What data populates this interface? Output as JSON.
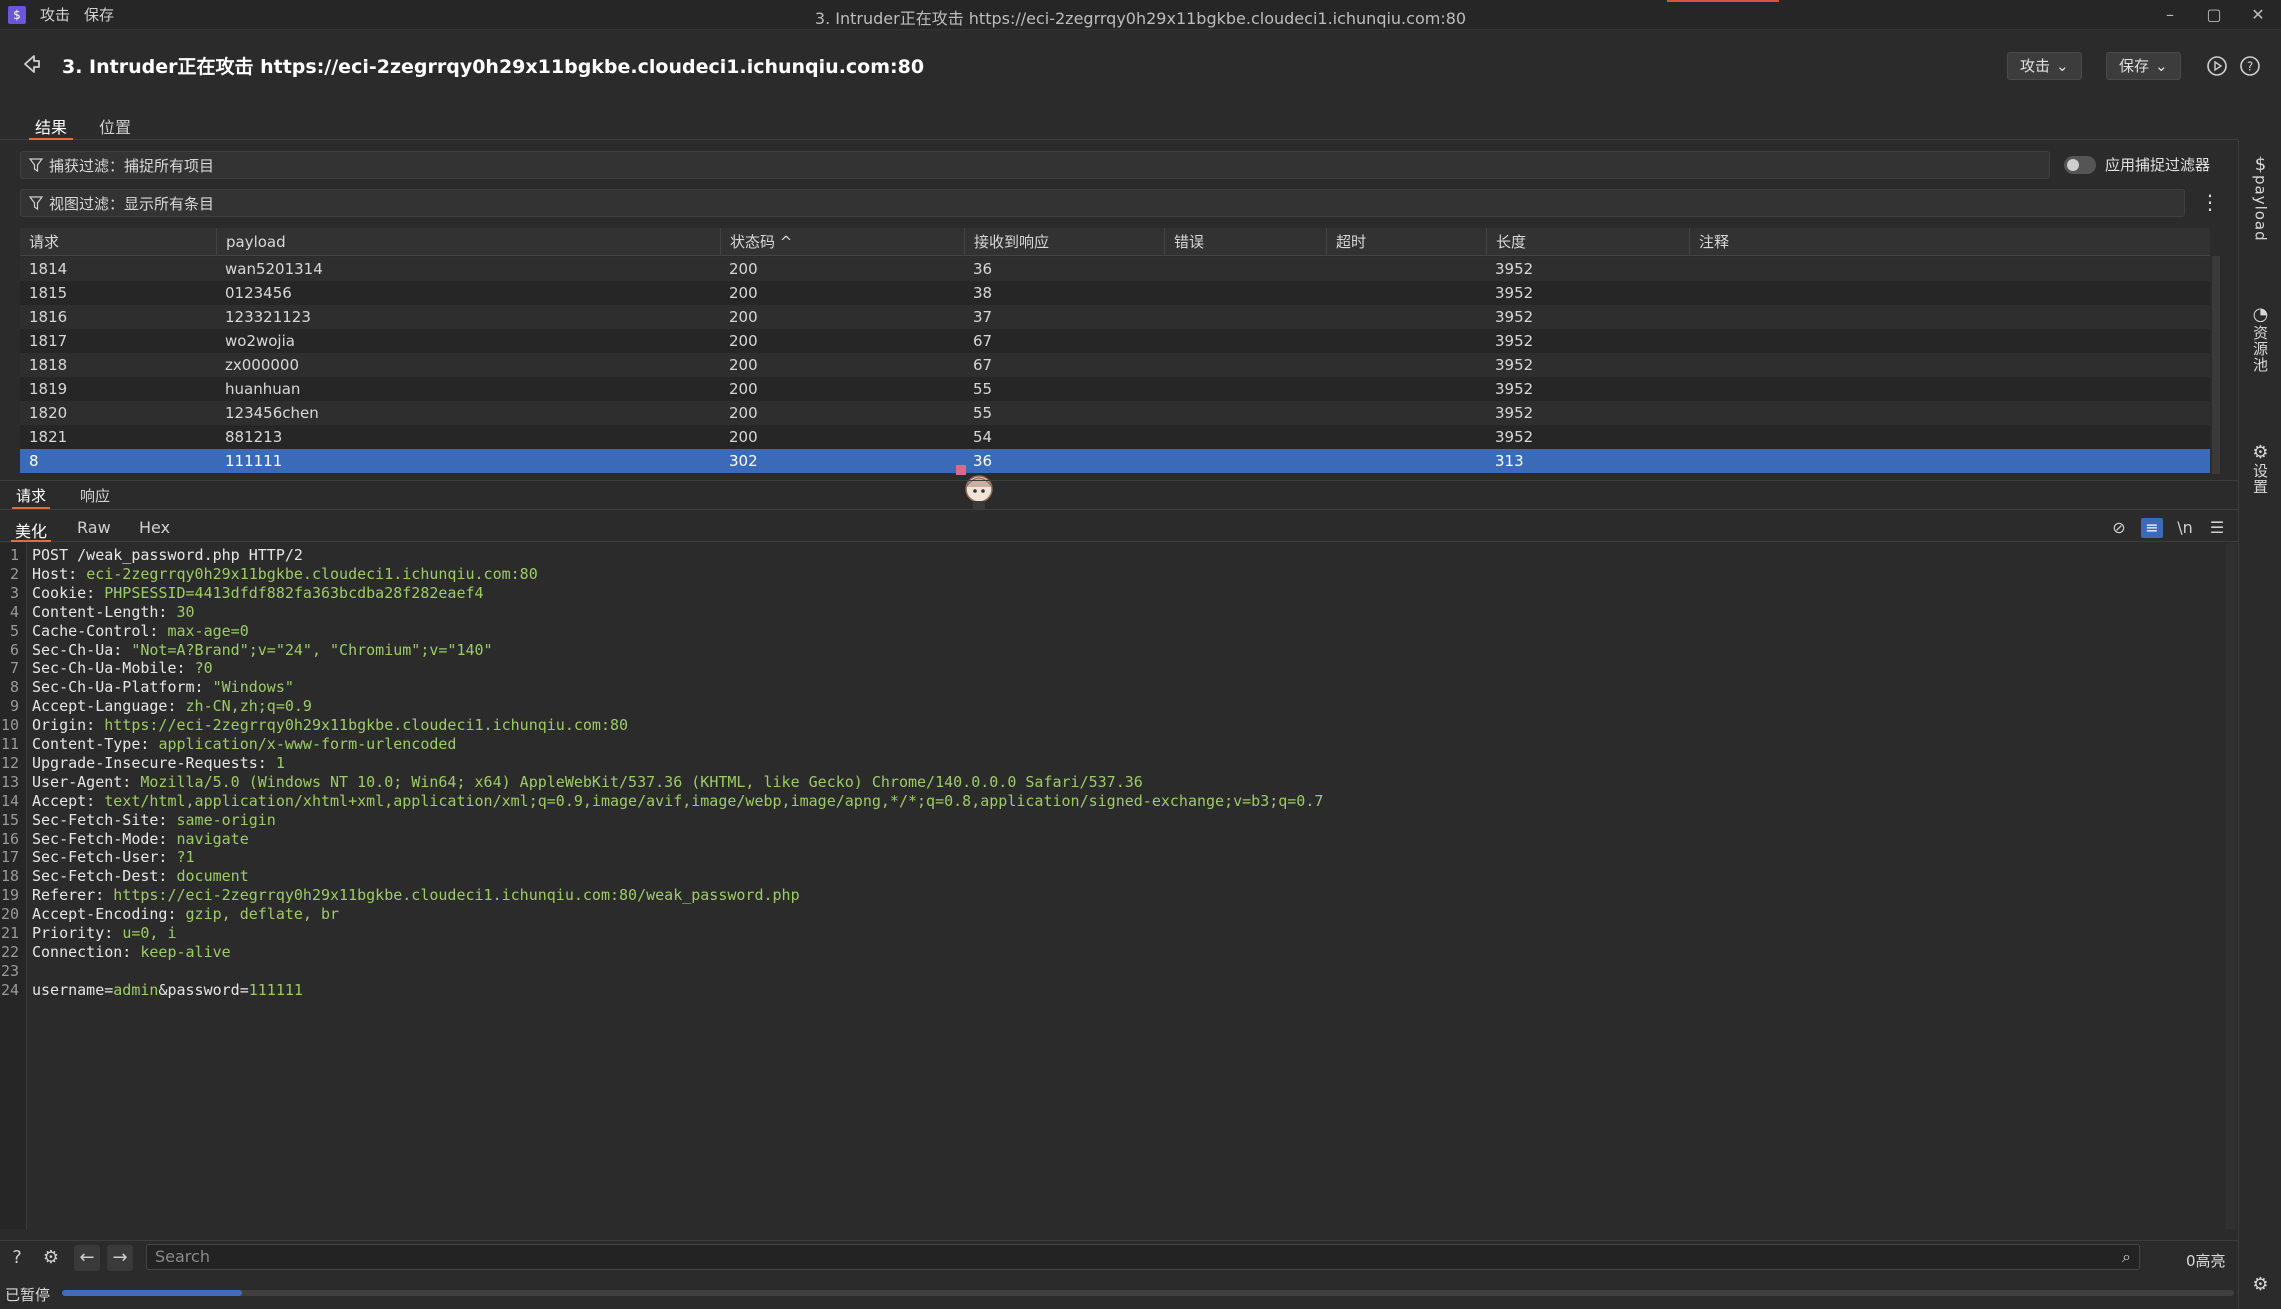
{
  "titlebar": {
    "menu": [
      "攻击",
      "保存"
    ],
    "window_title": "3. Intruder正在攻击 https://eci-2zegrrqy0h29x11bgkbe.cloudeci1.ichunqiu.com:80"
  },
  "header": {
    "title": "3. Intruder正在攻击 https://eci-2zegrrqy0h29x11bgkbe.cloudeci1.ichunqiu.com:80",
    "attack_btn": "攻击",
    "save_btn": "保存"
  },
  "tabs": [
    "结果",
    "位置"
  ],
  "capture_filter": "捕获过滤：捕捉所有项目",
  "view_filter": "视图过滤：显示所有条目",
  "apply_capture_filter": "应用捕捉过滤器",
  "table": {
    "columns": [
      "请求",
      "payload",
      "状态码 ^",
      "接收到响应",
      "错误",
      "超时",
      "长度",
      "注释"
    ],
    "rows": [
      [
        "1814",
        "wan5201314",
        "200",
        "36",
        "",
        "",
        "3952",
        ""
      ],
      [
        "1815",
        "0123456",
        "200",
        "38",
        "",
        "",
        "3952",
        ""
      ],
      [
        "1816",
        "123321123",
        "200",
        "37",
        "",
        "",
        "3952",
        ""
      ],
      [
        "1817",
        "wo2wojia",
        "200",
        "67",
        "",
        "",
        "3952",
        ""
      ],
      [
        "1818",
        "zx000000",
        "200",
        "67",
        "",
        "",
        "3952",
        ""
      ],
      [
        "1819",
        "huanhuan",
        "200",
        "55",
        "",
        "",
        "3952",
        ""
      ],
      [
        "1820",
        "123456chen",
        "200",
        "55",
        "",
        "",
        "3952",
        ""
      ],
      [
        "1821",
        "881213",
        "200",
        "54",
        "",
        "",
        "3952",
        ""
      ],
      [
        "8",
        "111111",
        "302",
        "36",
        "",
        "",
        "313",
        ""
      ]
    ],
    "selected_row": 8
  },
  "sidebar": {
    "payload": "payload",
    "resource_pool": "资源池",
    "settings": "设置"
  },
  "subtabs": [
    "请求",
    "响应"
  ],
  "viewtabs": [
    "美化",
    "Raw",
    "Hex"
  ],
  "editor": {
    "lines": [
      {
        "k": "POST /weak_password.php HTTP/2",
        "v": ""
      },
      {
        "k": "Host: ",
        "v": "eci-2zegrrqy0h29x11bgkbe.cloudeci1.ichunqiu.com:80"
      },
      {
        "k": "Cookie: ",
        "v": "PHPSESSID=4413dfdf882fa363bcdba28f282eaef4"
      },
      {
        "k": "Content-Length: ",
        "v": "30"
      },
      {
        "k": "Cache-Control: ",
        "v": "max-age=0"
      },
      {
        "k": "Sec-Ch-Ua: ",
        "v": "\"Not=A?Brand\";v=\"24\", \"Chromium\";v=\"140\""
      },
      {
        "k": "Sec-Ch-Ua-Mobile: ",
        "v": "?0"
      },
      {
        "k": "Sec-Ch-Ua-Platform: ",
        "v": "\"Windows\""
      },
      {
        "k": "Accept-Language: ",
        "v": "zh-CN,zh;q=0.9"
      },
      {
        "k": "Origin: ",
        "v": "https://eci-2zegrrqy0h29x11bgkbe.cloudeci1.ichunqiu.com:80"
      },
      {
        "k": "Content-Type: ",
        "v": "application/x-www-form-urlencoded"
      },
      {
        "k": "Upgrade-Insecure-Requests: ",
        "v": "1"
      },
      {
        "k": "User-Agent: ",
        "v": "Mozilla/5.0 (Windows NT 10.0; Win64; x64) AppleWebKit/537.36 (KHTML, like Gecko) Chrome/140.0.0.0 Safari/537.36"
      },
      {
        "k": "Accept: ",
        "v": "text/html,application/xhtml+xml,application/xml;q=0.9,image/avif,image/webp,image/apng,*/*;q=0.8,application/signed-exchange;v=b3;q=0.7"
      },
      {
        "k": "Sec-Fetch-Site: ",
        "v": "same-origin"
      },
      {
        "k": "Sec-Fetch-Mode: ",
        "v": "navigate"
      },
      {
        "k": "Sec-Fetch-User: ",
        "v": "?1"
      },
      {
        "k": "Sec-Fetch-Dest: ",
        "v": "document"
      },
      {
        "k": "Referer: ",
        "v": "https://eci-2zegrrqy0h29x11bgkbe.cloudeci1.ichunqiu.com:80/weak_password.php"
      },
      {
        "k": "Accept-Encoding: ",
        "v": "gzip, deflate, br"
      },
      {
        "k": "Priority: ",
        "v": "u=0, i"
      },
      {
        "k": "Connection: ",
        "v": "keep-alive"
      },
      {
        "k": "",
        "v": ""
      },
      {
        "k": "username=",
        "v": "admin",
        "k2": "&password=",
        "v2": "111111"
      }
    ]
  },
  "bottombar": {
    "search_placeholder": "Search",
    "highlights": "0高亮"
  },
  "status": {
    "text": "已暂停",
    "progress": 0.083
  },
  "colors": {
    "accent": "#e46b3c",
    "selected_row": "#3a6ab8",
    "value_green": "#9ccc65"
  },
  "icons": {
    "app": "burp-icon",
    "back": "back-arrow-icon",
    "filter": "filter-icon",
    "play": "play-circle-icon",
    "help": "help-circle-icon"
  }
}
